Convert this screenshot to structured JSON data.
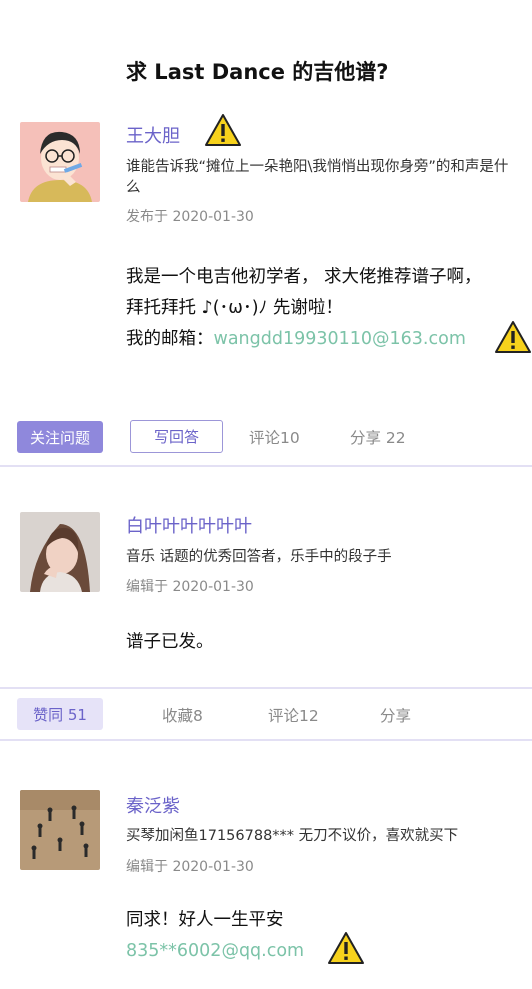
{
  "question": {
    "title": "求 Last Dance 的吉他谱?",
    "author": {
      "name": "王大胆",
      "bio": "谁能告诉我“摊位上一朵艳阳\\我悄悄出现你身旁”的和声是什么",
      "published": "发布于 2020-01-30"
    },
    "body": {
      "line1": "我是一个电吉他初学者， 求大佬推荐谱子啊，",
      "line2": "拜托拜托 ♪(･ω･)ﾉ 先谢啦！",
      "email_label": "我的邮箱：",
      "email": "wangdd19930110@163.com"
    },
    "actions": {
      "follow": "关注问题",
      "answer": "写回答",
      "comment": "评论10",
      "share": "分享 22"
    }
  },
  "answers": [
    {
      "name": "白叶叶叶叶叶叶",
      "bio": "音乐 话题的优秀回答者，乐手中的段子手",
      "edited": "编辑于 2020-01-30",
      "body": "谱子已发。",
      "actions": {
        "like": "赞同 51",
        "favorite": "收藏8",
        "comment": "评论12",
        "share": "分享"
      }
    },
    {
      "name": "秦泛紫",
      "bio": "买琴加闲鱼17156788*** 无刀不议价，喜欢就买下",
      "edited": "编辑于 2020-01-30",
      "body": "同求！好人一生平安",
      "email": "835**6002@qq.com"
    }
  ],
  "icons": {
    "warning": "warning-icon",
    "warning_color": "#f7d21c"
  }
}
